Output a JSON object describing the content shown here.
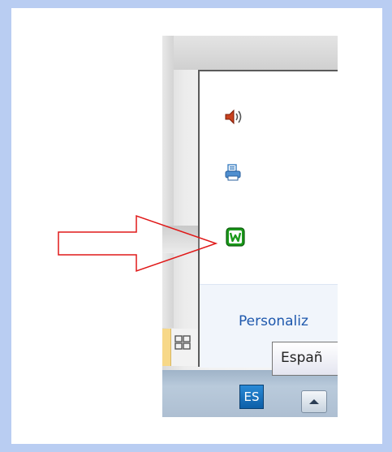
{
  "tray": {
    "icons": [
      {
        "name": "speaker-volume-icon",
        "color": "#c8411e"
      },
      {
        "name": "printer-icon",
        "color": "#3c7fc2"
      },
      {
        "name": "w-app-icon",
        "color": "#1a9a1a",
        "glyph": "W"
      }
    ],
    "customize_link": "Personaliz"
  },
  "taskbar": {
    "language_code": "ES",
    "tooltip": "Españ"
  },
  "annotation": {
    "arrow_color": "#e01818"
  }
}
